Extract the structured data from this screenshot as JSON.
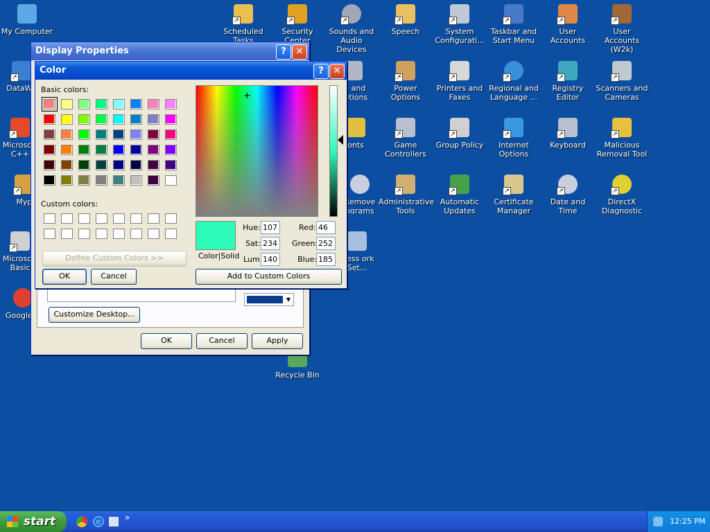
{
  "desktop": {
    "icons": [
      {
        "label": "My Computer",
        "color": "#5fa8e8"
      },
      {
        "label": "DataWa",
        "color": "#3b7fd0"
      },
      {
        "label": "Microsoft C++",
        "color": "#e24a2a"
      },
      {
        "label": "Myp",
        "color": "#d8a040"
      },
      {
        "label": "Microsoft Basic",
        "color": "#d0d0d0"
      },
      {
        "label": "Google C",
        "color": "#e04030"
      },
      {
        "label": "Scheduled Tasks",
        "color": "#e8c050"
      },
      {
        "label": "Security Center",
        "color": "#e0a020"
      },
      {
        "label": "Sounds and Audio Devices",
        "color": "#a0a8b8"
      },
      {
        "label": "Speech",
        "color": "#e8c060"
      },
      {
        "label": "System Configurati...",
        "color": "#c0c8d8"
      },
      {
        "label": "Taskbar and Start Menu",
        "color": "#4878c8"
      },
      {
        "label": "User Accounts",
        "color": "#e08848"
      },
      {
        "label": "User Accounts (W2k)",
        "color": "#a06838"
      },
      {
        "label": "se and Options",
        "color": "#b0b8c8"
      },
      {
        "label": "Power Options",
        "color": "#d0a060"
      },
      {
        "label": "Printers and Faxes",
        "color": "#d8d8d8"
      },
      {
        "label": "Regional and Language ...",
        "color": "#3890d8"
      },
      {
        "label": "Registry Editor",
        "color": "#40a8c0"
      },
      {
        "label": "Scanners and Cameras",
        "color": "#c0c8d0"
      },
      {
        "label": "onts",
        "color": "#e0c040"
      },
      {
        "label": "Game Controllers",
        "color": "#b8c0d0"
      },
      {
        "label": "Group Policy",
        "color": "#d0d0d0"
      },
      {
        "label": "Internet Options",
        "color": "#3898e0"
      },
      {
        "label": "Keyboard",
        "color": "#b8c0d0"
      },
      {
        "label": "Malicious Removal Tool",
        "color": "#e8c040"
      },
      {
        "label": "Remove ograms",
        "color": "#c8d0e0"
      },
      {
        "label": "Administrative Tools",
        "color": "#d0b070"
      },
      {
        "label": "Automatic Updates",
        "color": "#48a048"
      },
      {
        "label": "Certificate Manager",
        "color": "#d8c890"
      },
      {
        "label": "Date and Time",
        "color": "#c8d0e0"
      },
      {
        "label": "DirectX Diagnostic",
        "color": "#e0d030"
      },
      {
        "label": "eless ork Set...",
        "color": "#a8c0e0"
      },
      {
        "label": "Recycle Bin",
        "color": "#58a858"
      }
    ]
  },
  "display_properties": {
    "title": "Display Properties",
    "help": "?",
    "close": "✕",
    "customize_desktop": "Customize Desktop...",
    "color_button_value": "#0c3c8c",
    "ok": "OK",
    "cancel": "Cancel",
    "apply": "Apply"
  },
  "color_dialog": {
    "title": "Color",
    "help": "?",
    "close": "✕",
    "basic_colors_label": "Basic colors:",
    "custom_colors_label": "Custom colors:",
    "define_custom": "Define Custom Colors >>",
    "ok": "OK",
    "cancel": "Cancel",
    "add_to_custom": "Add to Custom Colors",
    "color_solid_label": "Color|Solid",
    "preview_color": "#2efcb9",
    "hue_label": "Hue:",
    "hue": "107",
    "sat_label": "Sat:",
    "sat": "234",
    "lum_label": "Lum:",
    "lum": "140",
    "red_label": "Red:",
    "red": "46",
    "green_label": "Green:",
    "green": "252",
    "blue_label": "Blue:",
    "blue": "185",
    "basic_colors": [
      "#ff8080",
      "#ffff80",
      "#80ff80",
      "#00ff80",
      "#80ffff",
      "#0080ff",
      "#ff80c0",
      "#ff80ff",
      "#ff0000",
      "#ffff00",
      "#80ff00",
      "#00ff40",
      "#00ffff",
      "#0080c0",
      "#8080c0",
      "#ff00ff",
      "#804040",
      "#ff8040",
      "#00ff00",
      "#008080",
      "#004080",
      "#8080ff",
      "#800040",
      "#ff0080",
      "#800000",
      "#ff8000",
      "#008000",
      "#008040",
      "#0000ff",
      "#0000a0",
      "#800080",
      "#8000ff",
      "#400000",
      "#804000",
      "#004000",
      "#004040",
      "#000080",
      "#000040",
      "#400040",
      "#400080",
      "#000000",
      "#808000",
      "#808040",
      "#808080",
      "#408080",
      "#c0c0c0",
      "#400040",
      "#ffffff"
    ]
  },
  "taskbar": {
    "start_label": "start",
    "quicklaunch_more": "»",
    "clock": "12:25 PM"
  }
}
